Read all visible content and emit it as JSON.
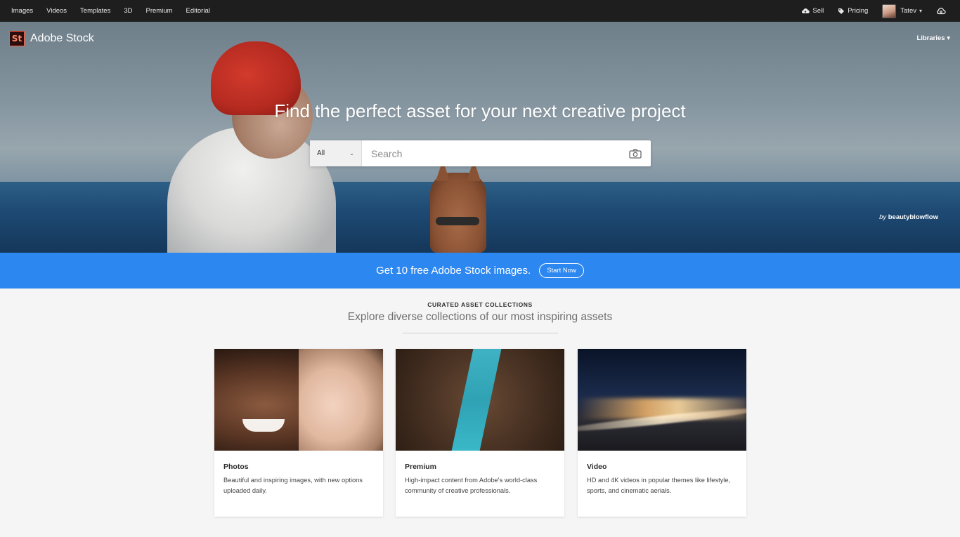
{
  "topnav": {
    "left_links": [
      "Images",
      "Videos",
      "Templates",
      "3D",
      "Premium",
      "Editorial"
    ],
    "sell_label": "Sell",
    "pricing_label": "Pricing",
    "user_name": "Tatev"
  },
  "hero": {
    "brand_logo": "St",
    "brand_name": "Adobe Stock",
    "libraries_label": "Libraries",
    "headline": "Find the perfect asset for your next creative project",
    "search": {
      "filter_value": "All",
      "placeholder": "Search"
    },
    "credit_by": "by",
    "credit_name": "beautyblowflow"
  },
  "promo": {
    "text": "Get 10 free Adobe Stock images.",
    "button_label": "Start Now",
    "color": "#2d87f0"
  },
  "collections": {
    "kicker": "CURATED ASSET COLLECTIONS",
    "subtitle": "Explore diverse collections of our most inspiring assets",
    "cards": [
      {
        "title": "Photos",
        "description": "Beautiful and inspiring images, with new options uploaded daily."
      },
      {
        "title": "Premium",
        "description": "High-impact content from Adobe's world-class community of creative professionals."
      },
      {
        "title": "Video",
        "description": "HD and 4K videos in popular themes like lifestyle, sports, and cinematic aerials."
      }
    ]
  },
  "icons": {
    "sell": "cloud-upload-icon",
    "pricing": "tag-icon",
    "creative_cloud": "creative-cloud-icon",
    "camera": "camera-icon"
  }
}
